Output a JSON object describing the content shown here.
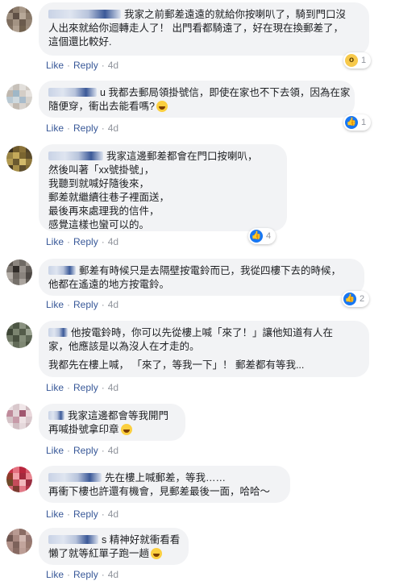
{
  "actions": {
    "like": "Like",
    "reply": "Reply",
    "separator": "·"
  },
  "comments": [
    {
      "lines": [
        "我家之前郵差遠遠的就給你按喇叭了，騎到門口沒",
        "人出來就給你迴轉走人了！ 出門看都騎遠了，好在現在換郵差了，",
        "這個還比較好."
      ],
      "time": "4d",
      "reaction": {
        "icon": "wow-icon",
        "count": "1"
      }
    },
    {
      "lines": [
        "u 我都去郵局領掛號信，即使在家也不下去領，因為在家",
        "隨便穿，衝出去能看嗎?"
      ],
      "time": "4d",
      "reaction": {
        "icon": "like-icon",
        "count": "1"
      }
    },
    {
      "lines": [
        "我家這邊郵差都會在門口按喇叭，",
        "然後叫著「xx號掛號」，",
        "我聽到就喊好隨後來，",
        "郵差就繼續往巷子裡面送，",
        "最後再來處理我的信件，",
        "感覺這樣也蠻可以的。"
      ],
      "time": "4d",
      "reaction": {
        "icon": "like-icon",
        "count": "4"
      }
    },
    {
      "lines": [
        "郵差有時候只是去隔壁按電鈴而已，我從四樓下去的時候，",
        "他都在遙遠的地方按電鈴。"
      ],
      "time": "4d",
      "reaction": {
        "icon": "like-icon",
        "count": "2"
      }
    },
    {
      "lines": [
        "他按電鈴時，你可以先從樓上喊「來了！」讓他知道有人在",
        "家，他應該是以為沒人在才走的。",
        "",
        "我都先在樓上喊， 「來了，等我一下」！ 郵差都有等我..."
      ],
      "time": "4d",
      "reaction": null
    },
    {
      "lines": [
        "我家這邊都會等我開門",
        "再喊掛號拿印章"
      ],
      "time": "4d",
      "reaction": null
    },
    {
      "lines": [
        "先在樓上喊郵差，等我……",
        "再衝下樓也許還有機會，見郵差最後一面，哈哈～"
      ],
      "time": "4d",
      "reaction": null
    },
    {
      "lines": [
        "s 精神好就衝看看",
        "懶了就等紅單子跑一趟"
      ],
      "time": "4d",
      "reaction": null
    }
  ],
  "colors": {
    "link": "#385898",
    "bubble": "#f2f3f5",
    "like": "#1877f2",
    "meta": "#90949c"
  }
}
